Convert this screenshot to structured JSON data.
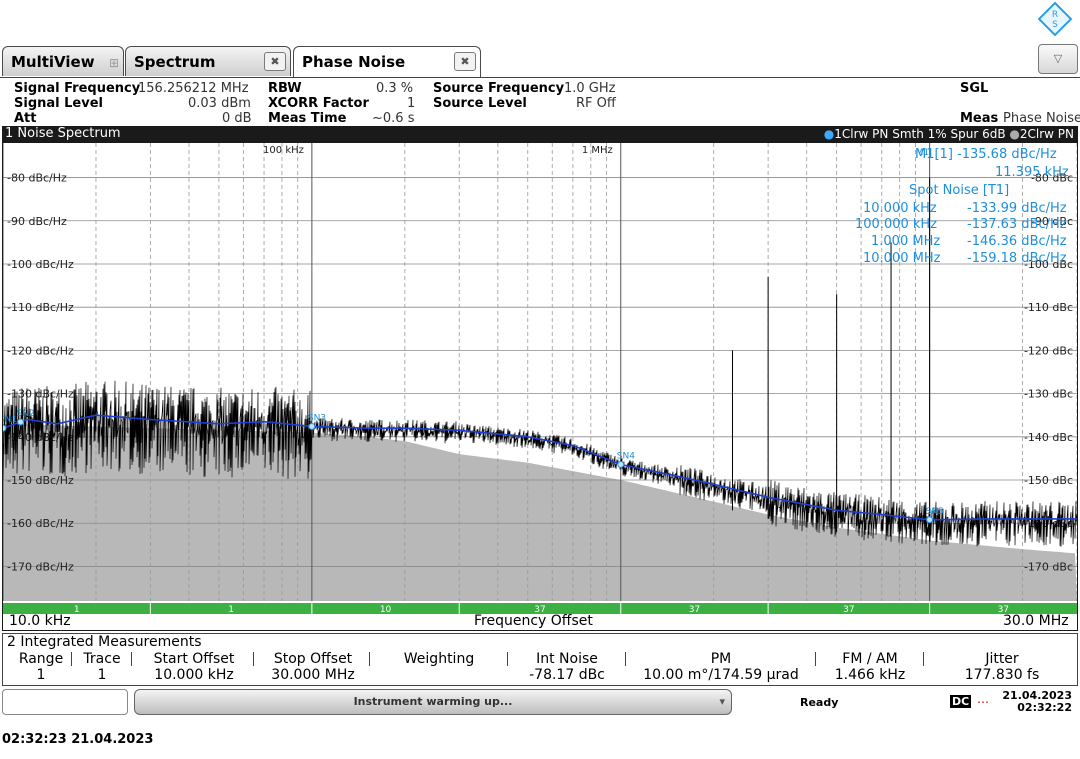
{
  "tabs": [
    {
      "label": "MultiView",
      "active": false
    },
    {
      "label": "Spectrum",
      "active": false
    },
    {
      "label": "Phase Noise",
      "active": true
    }
  ],
  "params": {
    "signal_frequency_label": "Signal Frequency",
    "signal_frequency": "156.256212 MHz",
    "signal_level_label": "Signal Level",
    "signal_level": "0.03 dBm",
    "att_label": "Att",
    "att": "0 dB",
    "rbw_label": "RBW",
    "rbw": "0.3 %",
    "xcorr_label": "XCORR Factor",
    "xcorr": "1",
    "meas_time_label": "Meas Time",
    "meas_time": "~0.6 s",
    "source_frequency_label": "Source Frequency",
    "source_frequency": "1.0 GHz",
    "source_level_label": "Source Level",
    "source_level": "RF Off",
    "sgl": "SGL",
    "meas_label": "Meas",
    "meas_value": "Phase Noise"
  },
  "noise_spectrum": {
    "title": "1 Noise Spectrum",
    "trace1_legend": "1Clrw PN Smth 1% Spur 6dB",
    "trace2_legend": "2Clrw PN",
    "marker_m1": "M1[1] -135.68 dBc/Hz",
    "marker_m1_freq": "11.395 kHz",
    "spot_noise_title": "Spot Noise [T1]",
    "spot_noise": [
      {
        "offset": "10.000 kHz",
        "value": "-133.99 dBc/Hz"
      },
      {
        "offset": "100.000 kHz",
        "value": "-137.63 dBc/Hz"
      },
      {
        "offset": "1.000 MHz",
        "value": "-146.36 dBc/Hz"
      },
      {
        "offset": "10.000 MHz",
        "value": "-159.18 dBc/Hz"
      }
    ],
    "x_start": "10.0 kHz",
    "x_stop": "30.0 MHz",
    "x_label": "Frequency Offset",
    "x_decade_labels": [
      "100 kHz",
      "1 MHz"
    ],
    "y_left_labels": [
      "-80 dBc/Hz",
      "-90 dBc/Hz",
      "-100 dBc/Hz",
      "-110 dBc/Hz",
      "-120 dBc/Hz",
      "-130 dBc/Hz",
      "-140 dBc/Hz",
      "-150 dBc/Hz",
      "-160 dBc/Hz",
      "-170 dBc/Hz"
    ],
    "y_right_labels": [
      "-80 dBc",
      "-90 dBc",
      "-100 dBc",
      "-110 dBc",
      "-120 dBc",
      "-130 dBc",
      "-140 dBc",
      "-150 dBc",
      "-160 dBc",
      "-170 dBc"
    ],
    "xcorr_bar_labels": [
      "1",
      "1",
      "10",
      "37",
      "37",
      "37",
      "37"
    ],
    "spot_markers": [
      "SN1",
      "SN2",
      "SN3",
      "SN4",
      "SN5"
    ],
    "m1_label": "M1"
  },
  "chart_data": {
    "type": "line",
    "title": "1 Noise Spectrum",
    "xlabel": "Frequency Offset",
    "ylabel": "dBc/Hz",
    "x_scale": "log",
    "xlim": [
      10000,
      30000000
    ],
    "ylim": [
      -178,
      -72
    ],
    "grid": true,
    "series": [
      {
        "name": "1Clrw PN Smth 1% Spur 6dB",
        "color": "#1f3fd0",
        "x": [
          10000,
          12000,
          15000,
          20000,
          30000,
          50000,
          70000,
          100000,
          150000,
          200000,
          300000,
          500000,
          700000,
          1000000,
          1500000,
          2000000,
          3000000,
          5000000,
          7000000,
          10000000,
          15000000,
          20000000,
          30000000
        ],
        "y": [
          -138,
          -136,
          -137,
          -135,
          -136,
          -137,
          -136.5,
          -137.6,
          -138,
          -138,
          -138.5,
          -140,
          -142,
          -146.4,
          -149,
          -151,
          -154,
          -157,
          -158,
          -159.2,
          -159,
          -159,
          -159
        ]
      },
      {
        "name": "2Clrw PN",
        "color": "#b8b8b8",
        "x": [
          10000,
          30000,
          100000,
          150000,
          200000,
          300000,
          500000,
          1000000,
          2000000,
          3000000,
          5000000,
          10000000,
          20000000,
          30000000
        ],
        "y": [
          -137,
          -138,
          -139,
          -140,
          -141,
          -144,
          -146,
          -150,
          -155,
          -158,
          -161,
          -164,
          -166,
          -167
        ]
      }
    ]
  },
  "integrated": {
    "title": "2 Integrated Measurements",
    "headers": [
      "Range",
      "Trace",
      "Start Offset",
      "Stop Offset",
      "Weighting",
      "Int Noise",
      "PM",
      "FM / AM",
      "Jitter"
    ],
    "row": [
      "1",
      "1",
      "10.000 kHz",
      "30.000 MHz",
      "",
      "-78.17 dBc",
      "10.00 m°/174.59 µrad",
      "1.466 kHz",
      "177.830 fs"
    ]
  },
  "status": {
    "message": "Instrument warming up...",
    "ready": "Ready",
    "dc": "DC",
    "date": "21.04.2023",
    "time": "02:32:22"
  },
  "footer_timestamp": "02:32:23  21.04.2023",
  "colors": {
    "trace_blue": "#1f3fd0",
    "trace_black": "#000000",
    "reference_gray": "#b8b8b8",
    "marker_cyan": "#1f8fdc",
    "xcorr_green": "#3cb043"
  }
}
